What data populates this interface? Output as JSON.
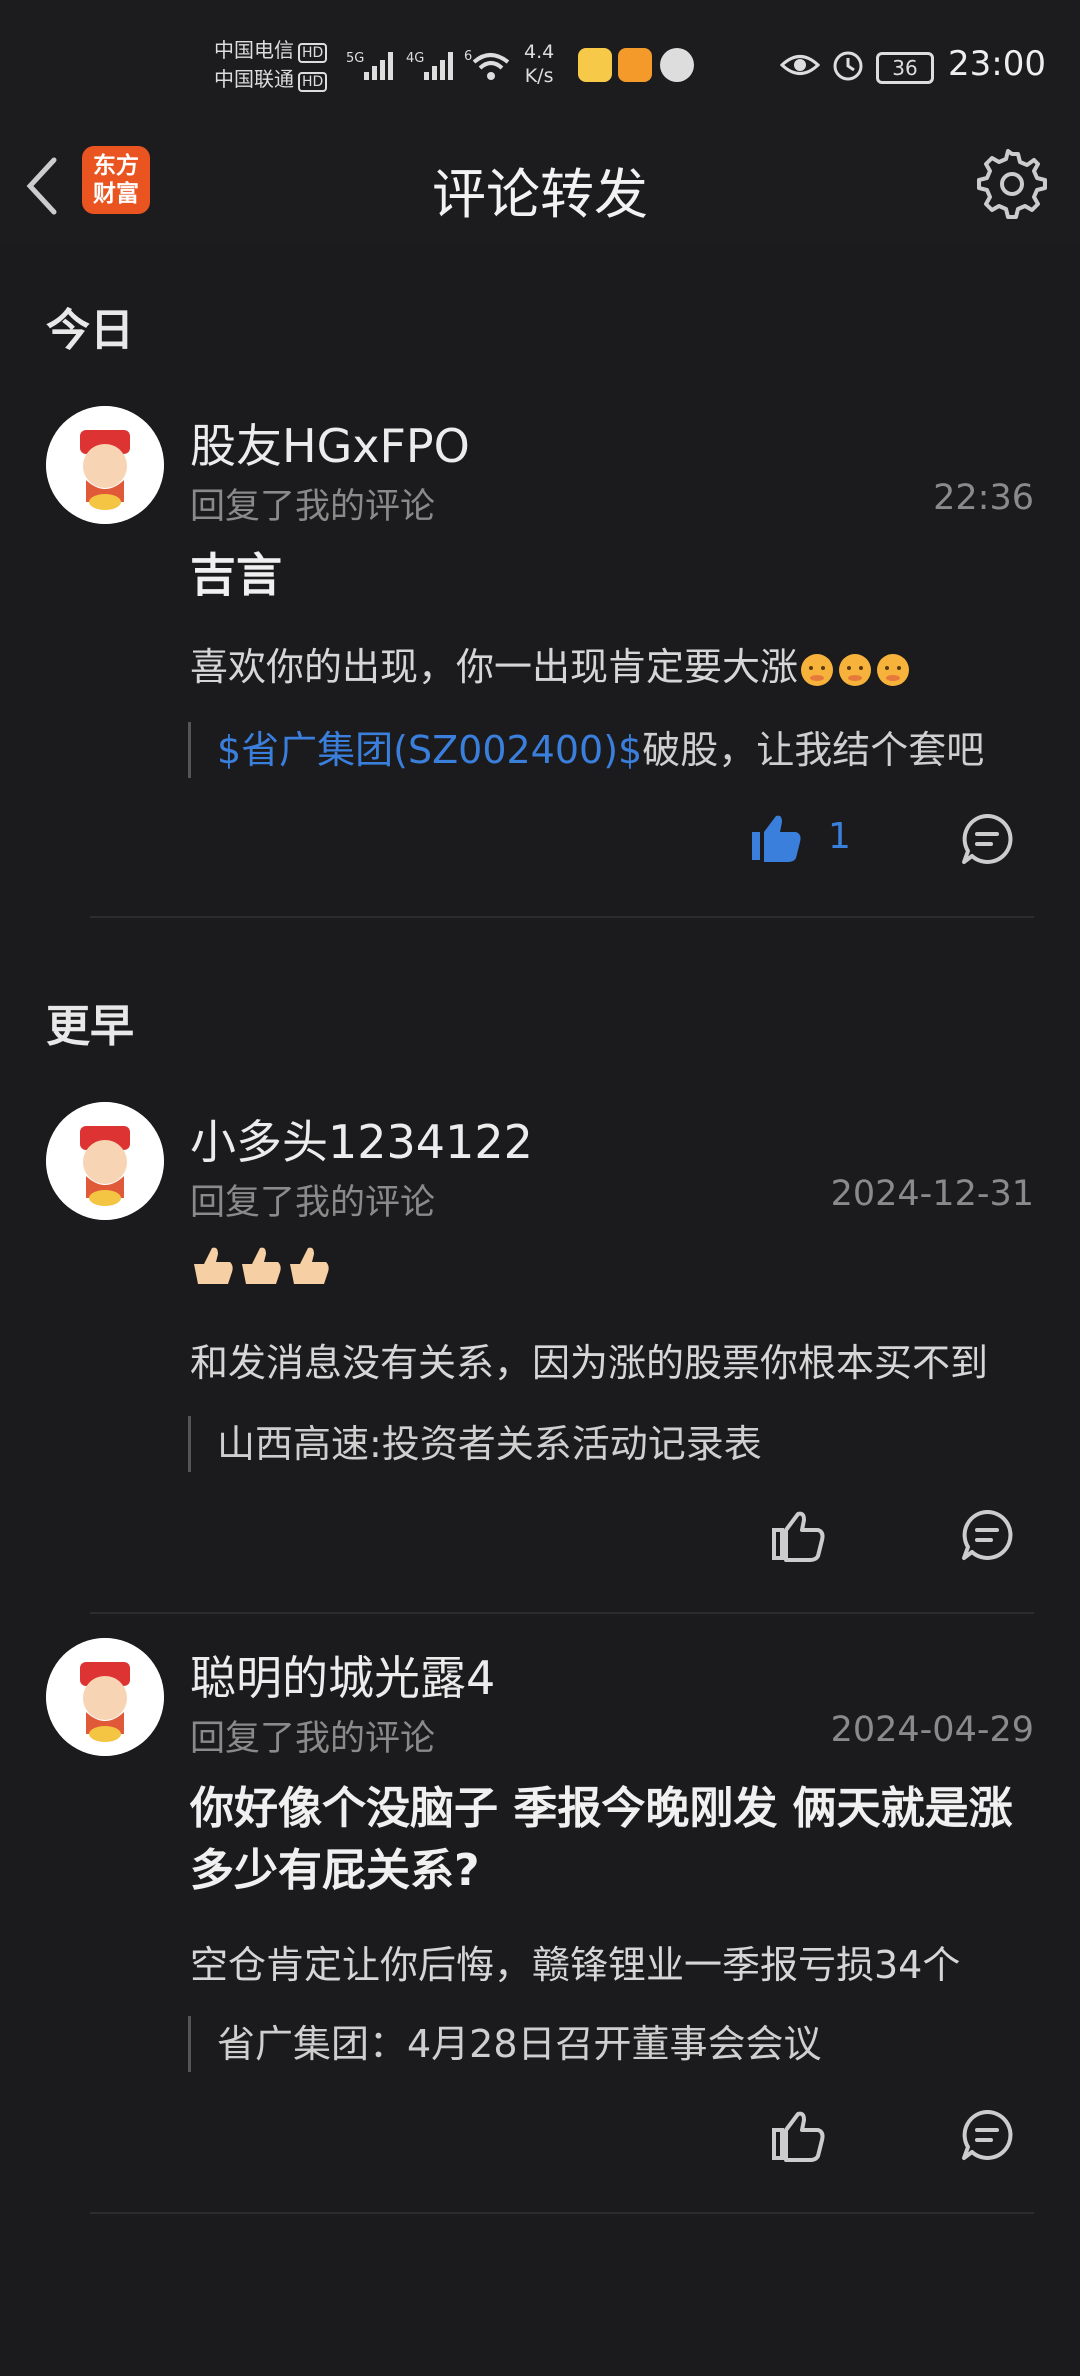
{
  "status_bar": {
    "carrier1": "中国电信",
    "carrier2": "中国联通",
    "hd": "HD",
    "net1": "5G",
    "net2": "4G",
    "net3": "6",
    "speed_value": "4.4",
    "speed_unit": "K/s",
    "battery": "36",
    "time": "23:00"
  },
  "nav": {
    "logo_line1": "东方",
    "logo_line2": "财富",
    "title": "评论转发"
  },
  "sections": {
    "today": "今日",
    "earlier": "更早"
  },
  "comments": [
    {
      "user": "股友HGxFPO",
      "action": "回复了我的评论",
      "time": "22:36",
      "headline": "吉言",
      "text": "喜欢你的出现，你一出现肯定要大涨",
      "quote_link": "$省广集团(SZ002400)$",
      "quote_text": "破股，让我结个套吧",
      "likes": "1",
      "liked": true
    },
    {
      "user": "小多头1234122",
      "action": "回复了我的评论",
      "time": "2024-12-31",
      "text": "和发消息没有关系，因为涨的股票你根本买不到",
      "quote_text": "山西高速:投资者关系活动记录表",
      "liked": false
    },
    {
      "user": "聪明的城光露4",
      "action": "回复了我的评论",
      "time": "2024-04-29",
      "headline": "你好像个没脑子 季报今晚刚发 俩天就是涨多少有屁关系?",
      "text": "空仓肯定让你后悔，赣锋锂业一季报亏损34个",
      "quote_text": "省广集团：4月28日召开董事会会议",
      "liked": false
    }
  ],
  "colors": {
    "accent": "#3b7fdc",
    "logo": "#ea5420",
    "background": "#1c1c1e"
  }
}
